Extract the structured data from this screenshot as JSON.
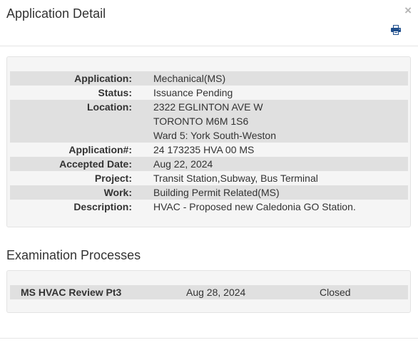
{
  "modal": {
    "title": "Application Detail",
    "close_glyph": "×",
    "print_icon": "printer-icon"
  },
  "detail": {
    "rows": [
      {
        "label": "Application:",
        "values": [
          "Mechanical(MS)"
        ]
      },
      {
        "label": "Status:",
        "values": [
          "Issuance Pending"
        ]
      },
      {
        "label": "Location:",
        "values": [
          "2322 EGLINTON AVE W",
          "TORONTO M6M 1S6",
          "Ward 5: York South-Weston"
        ]
      },
      {
        "label": "Application#:",
        "values": [
          "24 173235 HVA 00 MS"
        ]
      },
      {
        "label": "Accepted Date:",
        "values": [
          "Aug 22, 2024"
        ]
      },
      {
        "label": "Project:",
        "values": [
          "Transit Station,Subway, Bus Terminal"
        ]
      },
      {
        "label": "Work:",
        "values": [
          "Building Permit Related(MS)"
        ]
      },
      {
        "label": "Description:",
        "values": [
          "HVAC - Proposed new Caledonia GO Station."
        ]
      }
    ]
  },
  "examination": {
    "title": "Examination Processes",
    "rows": [
      {
        "name": "MS HVAC Review Pt3",
        "date": "Aug 28, 2024",
        "status": "Closed"
      }
    ]
  },
  "colors": {
    "shaded_row": "#e0e0e0",
    "panel_bg": "#f5f5f5",
    "print_icon": "#1f4e8c"
  }
}
